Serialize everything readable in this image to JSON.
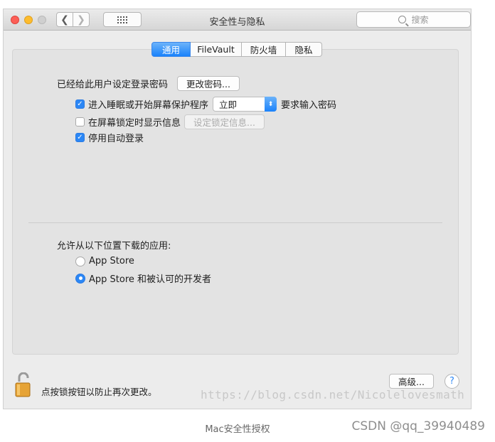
{
  "window": {
    "title": "安全性与隐私",
    "search_placeholder": "搜索",
    "grid_icon": "⋮⋮⋮⋮",
    "back_icon": "❮",
    "forward_icon": "❯"
  },
  "tabs": [
    {
      "label": "通用",
      "active": true
    },
    {
      "label": "FileVault",
      "active": false
    },
    {
      "label": "防火墙",
      "active": false
    },
    {
      "label": "隐私",
      "active": false
    }
  ],
  "general": {
    "password_set_label": "已经给此用户设定登录密码",
    "change_password_button": "更改密码...",
    "require_password": {
      "checked": true,
      "label": "进入睡眠或开始屏幕保护程序",
      "select_value": "立即",
      "suffix": "要求输入密码"
    },
    "show_message": {
      "checked": false,
      "label": "在屏幕锁定时显示信息",
      "button": "设定锁定信息..."
    },
    "disable_autologin": {
      "checked": true,
      "label": "停用自动登录"
    }
  },
  "download": {
    "heading": "允许从以下位置下载的应用:",
    "options": [
      {
        "label": "App Store",
        "selected": false
      },
      {
        "label": "App Store 和被认可的开发者",
        "selected": true
      }
    ]
  },
  "footer": {
    "lock_text": "点按锁按钮以防止再次更改。",
    "advanced_button": "高级...",
    "help_label": "?"
  },
  "watermark": "https://blog.csdn.net/Nicolelovesmath",
  "caption": "Mac安全性授权",
  "credit": "CSDN @qq_39940489",
  "colors": {
    "accent": "#2c87f5",
    "close": "#fc5f57",
    "minimize": "#fdbc2e"
  }
}
